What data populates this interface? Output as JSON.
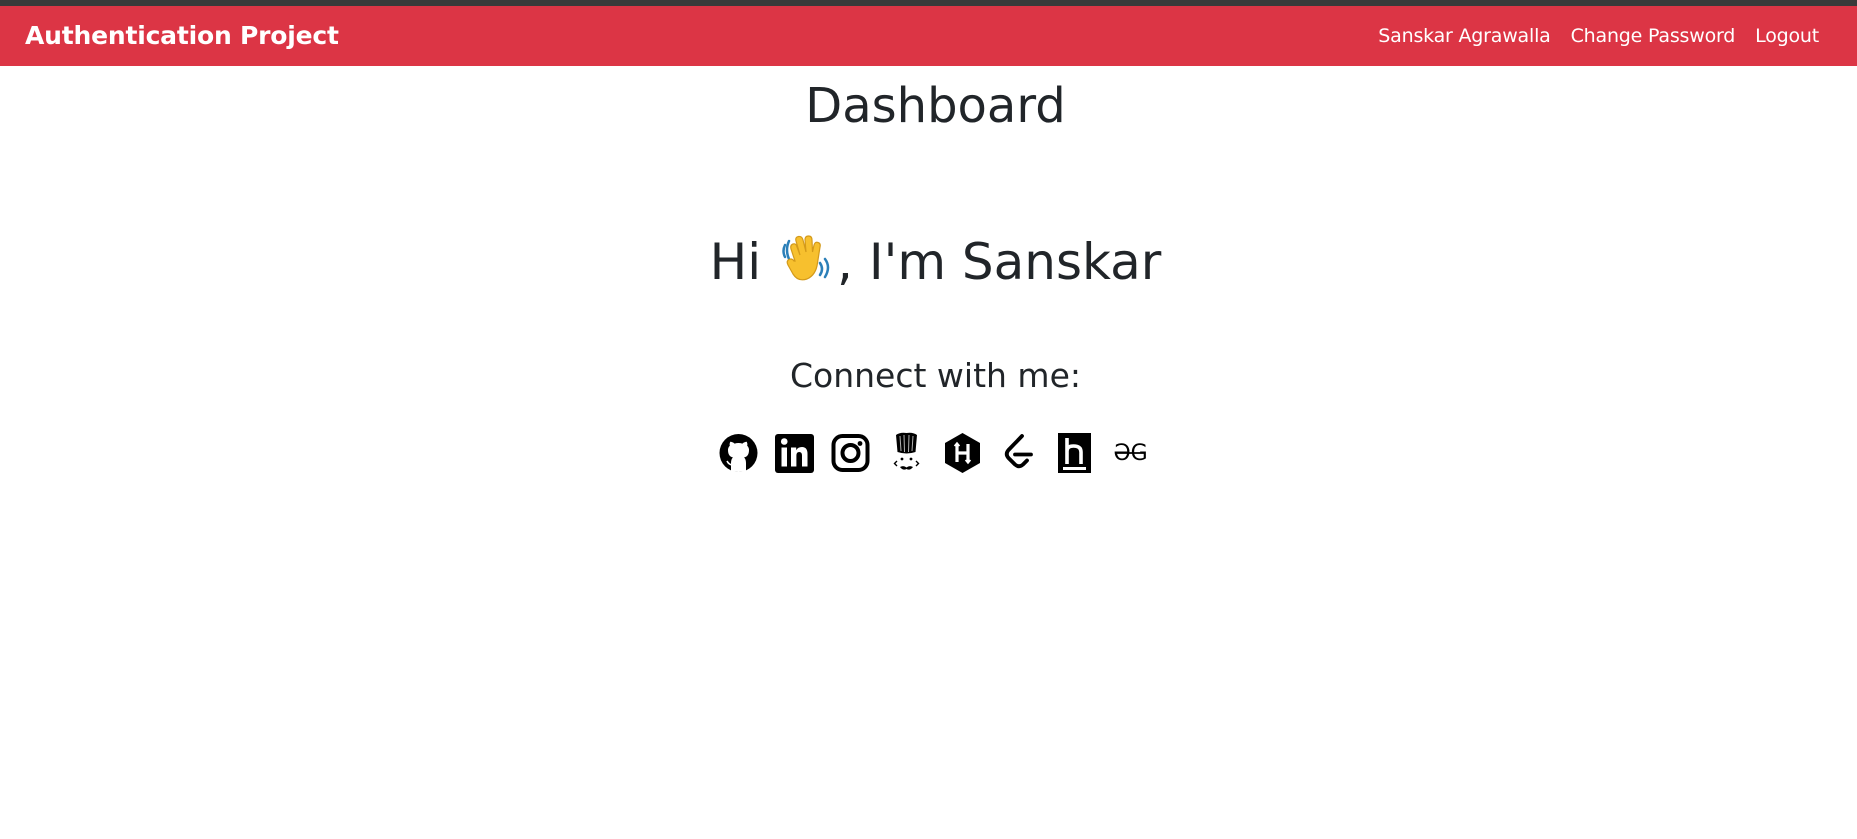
{
  "navbar": {
    "brand": "Authentication Project",
    "links": [
      "Sanskar Agrawalla",
      "Change Password",
      "Logout"
    ],
    "background": "#dc3545"
  },
  "main": {
    "title": "Dashboard",
    "greeting_before": "Hi ",
    "greeting_after": ", I'm Sanskar",
    "wave_icon": "waving-hand-emoji",
    "connect_heading": "Connect with me:",
    "social_icons": [
      "github-icon",
      "linkedin-icon",
      "instagram-icon",
      "codechef-icon",
      "hackerrank-icon",
      "leetcode-icon",
      "hackerearth-icon",
      "geeksforgeeks-icon"
    ],
    "geeksforgeeks_text": "ƏG"
  }
}
